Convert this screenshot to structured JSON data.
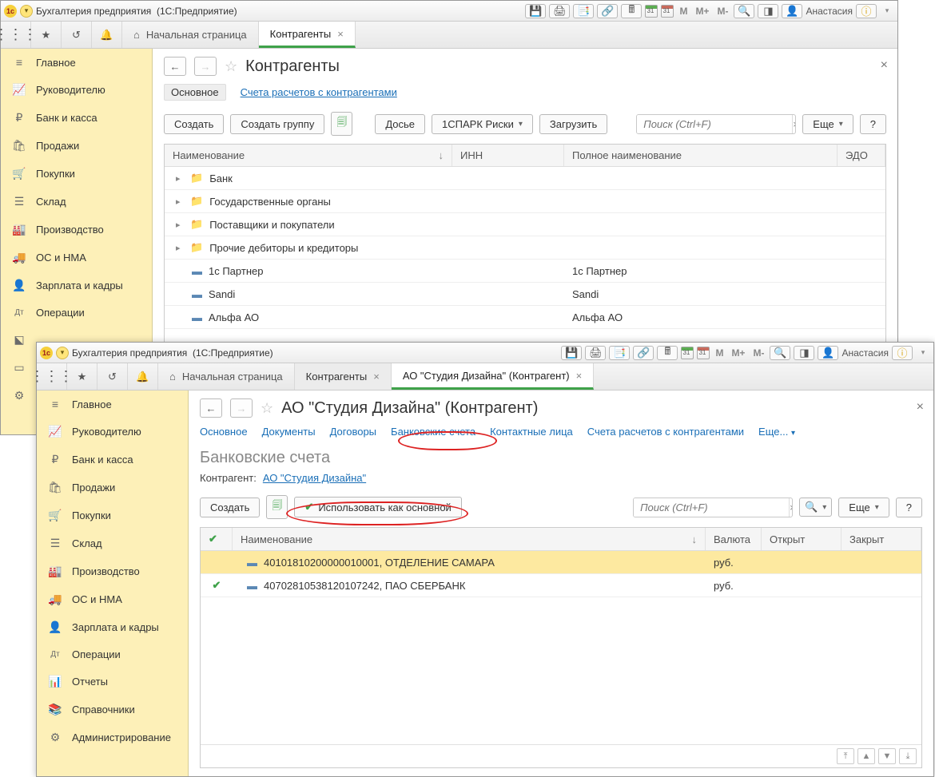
{
  "app": {
    "title_prefix": "Бухгалтерия предприятия",
    "title_suffix": "(1С:Предприятие)",
    "user": "Анастасия"
  },
  "ml": {
    "m": "M",
    "mplus": "M+",
    "mminus": "M-"
  },
  "sidebar": {
    "items": [
      {
        "icon": "≡",
        "label": "Главное"
      },
      {
        "icon": "📈",
        "label": "Руководителю"
      },
      {
        "icon": "₽",
        "label": "Банк и касса"
      },
      {
        "icon": "🛍",
        "label": "Продажи"
      },
      {
        "icon": "🛒",
        "label": "Покупки"
      },
      {
        "icon": "☰",
        "label": "Склад"
      },
      {
        "icon": "🏭",
        "label": "Производство"
      },
      {
        "icon": "🚚",
        "label": "ОС и НМА"
      },
      {
        "icon": "👤",
        "label": "Зарплата и кадры"
      },
      {
        "icon": "Дт",
        "label": "Операции"
      },
      {
        "icon": "📊",
        "label": "Отчеты"
      },
      {
        "icon": "📚",
        "label": "Справочники"
      },
      {
        "icon": "⚙",
        "label": "Администрирование"
      }
    ]
  },
  "win1": {
    "tabs": {
      "home": "Начальная страница",
      "t1": "Контрагенты"
    },
    "page_title": "Контрагенты",
    "subtabs": {
      "main": "Основное",
      "accounts": "Счета расчетов с контрагентами"
    },
    "toolbar": {
      "create": "Создать",
      "create_group": "Создать группу",
      "dossier": "Досье",
      "spark": "1СПАРК Риски",
      "load": "Загрузить",
      "search_ph": "Поиск (Ctrl+F)",
      "more": "Еще",
      "help": "?"
    },
    "columns": {
      "name": "Наименование",
      "inn": "ИНН",
      "full": "Полное наименование",
      "edo": "ЭДО"
    },
    "rows": [
      {
        "type": "folder",
        "name": "Банк"
      },
      {
        "type": "folder",
        "name": "Государственные органы"
      },
      {
        "type": "folder",
        "name": "Поставщики и покупатели"
      },
      {
        "type": "folder",
        "name": "Прочие дебиторы и кредиторы"
      },
      {
        "type": "item",
        "name": "1с Партнер",
        "full": "1с Партнер"
      },
      {
        "type": "item",
        "name": "Sandi",
        "full": "Sandi"
      },
      {
        "type": "item",
        "name": "Альфа АО",
        "full": "Альфа АО"
      }
    ]
  },
  "win2": {
    "tabs": {
      "home": "Начальная страница",
      "t1": "Контрагенты",
      "t2": "АО \"Студия Дизайна\" (Контрагент)"
    },
    "page_title": "АО \"Студия Дизайна\" (Контрагент)",
    "subtabs": {
      "main": "Основное",
      "docs": "Документы",
      "contracts": "Договоры",
      "bank": "Банковские счета",
      "contacts": "Контактные лица",
      "accounts": "Счета расчетов с контрагентами",
      "more": "Еще..."
    },
    "section": "Банковские счета",
    "field": {
      "label": "Контрагент:",
      "value": "АО \"Студия Дизайна\""
    },
    "toolbar": {
      "create": "Создать",
      "use_main": "Использовать как основной",
      "search_ph": "Поиск (Ctrl+F)",
      "more": "Еще",
      "help": "?"
    },
    "columns": {
      "name": "Наименование",
      "cur": "Валюта",
      "open": "Открыт",
      "close": "Закрыт"
    },
    "rows": [
      {
        "main": false,
        "name": "40101810200000010001, ОТДЕЛЕНИЕ САМАРА",
        "cur": "руб.",
        "sel": true
      },
      {
        "main": true,
        "name": "40702810538120107242, ПАО СБЕРБАНК",
        "cur": "руб.",
        "sel": false
      }
    ]
  }
}
